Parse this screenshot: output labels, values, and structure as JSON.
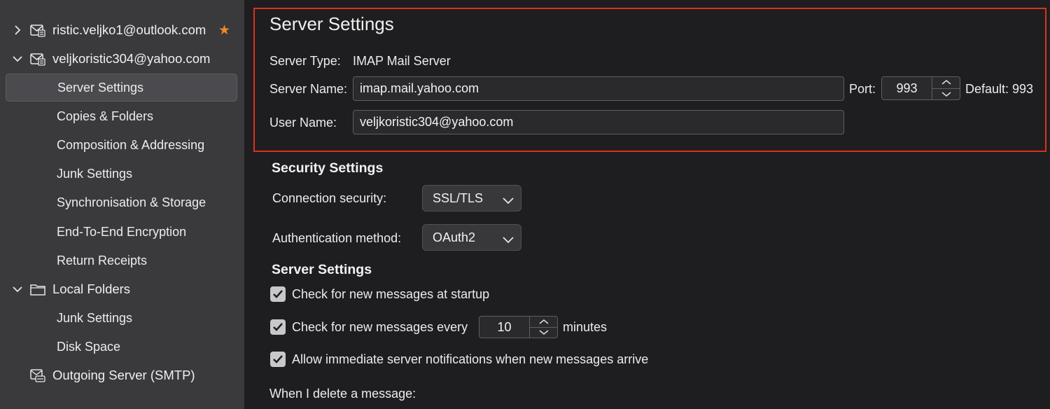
{
  "sidebar": {
    "accounts": [
      {
        "label": "ristic.veljko1@outlook.com",
        "expanded": false,
        "starred": true
      },
      {
        "label": "veljkoristic304@yahoo.com",
        "expanded": true
      }
    ],
    "sub_items": [
      "Server Settings",
      "Copies & Folders",
      "Composition & Addressing",
      "Junk Settings",
      "Synchronisation & Storage",
      "End-To-End Encryption",
      "Return Receipts"
    ],
    "local_folders": {
      "label": "Local Folders",
      "items": [
        "Junk Settings",
        "Disk Space"
      ]
    },
    "outgoing": "Outgoing Server (SMTP)",
    "selected": "Server Settings"
  },
  "server": {
    "title": "Server Settings",
    "type_label": "Server Type:",
    "type_value": "IMAP Mail Server",
    "name_label": "Server Name:",
    "name_value": "imap.mail.yahoo.com",
    "port_label": "Port:",
    "port_value": "993",
    "default_label": "Default: 993",
    "user_label": "User Name:",
    "user_value": "veljkoristic304@yahoo.com"
  },
  "security": {
    "title": "Security Settings",
    "connection_label": "Connection security:",
    "connection_value": "SSL/TLS",
    "auth_label": "Authentication method:",
    "auth_value": "OAuth2"
  },
  "server_settings2": {
    "title": "Server Settings",
    "check_startup": "Check for new messages at startup",
    "check_every": "Check for new messages every",
    "interval_value": "10",
    "minutes": "minutes",
    "allow_notifications": "Allow immediate server notifications when new messages arrive",
    "delete_label": "When I delete a message:"
  },
  "colors": {
    "highlight_border": "#d8321f",
    "star": "#f08a24"
  }
}
